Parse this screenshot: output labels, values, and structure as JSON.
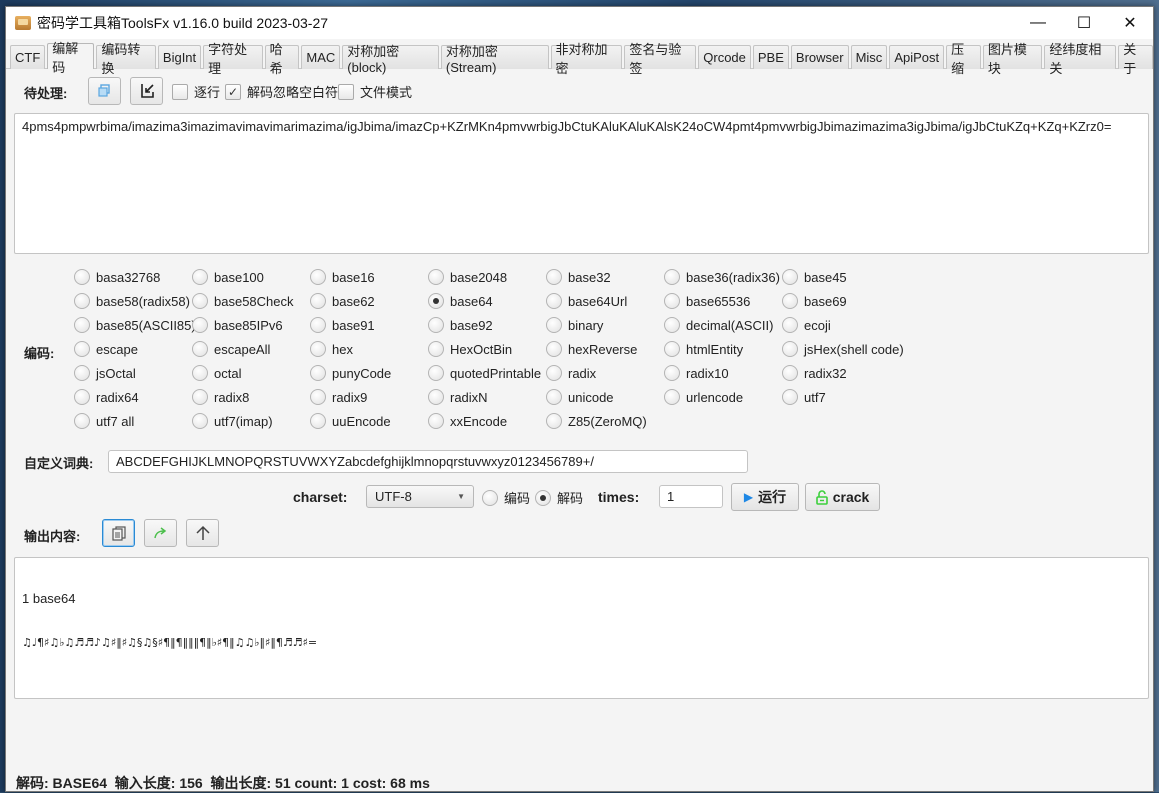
{
  "window": {
    "title": "密码学工具箱ToolsFx v1.16.0 build 2023-03-27",
    "controls": {
      "minimize": "—",
      "maximize": "☐",
      "close": "✕"
    }
  },
  "tabs": [
    {
      "label": "CTF",
      "active": false
    },
    {
      "label": "编解码",
      "active": true
    },
    {
      "label": "编码转换",
      "active": false
    },
    {
      "label": "BigInt",
      "active": false
    },
    {
      "label": "字符处理",
      "active": false
    },
    {
      "label": "哈希",
      "active": false
    },
    {
      "label": "MAC",
      "active": false
    },
    {
      "label": "对称加密(block)",
      "active": false
    },
    {
      "label": "对称加密(Stream)",
      "active": false
    },
    {
      "label": "非对称加密",
      "active": false
    },
    {
      "label": "签名与验签",
      "active": false
    },
    {
      "label": "Qrcode",
      "active": false
    },
    {
      "label": "PBE",
      "active": false
    },
    {
      "label": "Browser",
      "active": false
    },
    {
      "label": "Misc",
      "active": false
    },
    {
      "label": "ApiPost",
      "active": false
    },
    {
      "label": "压缩",
      "active": false
    },
    {
      "label": "图片模块",
      "active": false
    },
    {
      "label": "经纬度相关",
      "active": false
    },
    {
      "label": "关于",
      "active": false
    }
  ],
  "input_section": {
    "label": "待处理:",
    "buttons": [
      {
        "icon": "copy-icon"
      },
      {
        "icon": "import-icon"
      }
    ],
    "options": [
      {
        "label": "逐行",
        "checked": false
      },
      {
        "label": "解码忽略空白符",
        "checked": true
      },
      {
        "label": "文件模式",
        "checked": false
      }
    ],
    "value": "4pms4pmpwrbima/imazima3imazimavimavimarimazima/igJbima/imazCp+KZrMKn4pmvwrbigJbCtuKAluKAluKAlsK24oCW4pmt4pmvwrbigJbimazimazima3igJbima/igJbCtuKZq+KZq+KZrz0="
  },
  "encoding": {
    "label": "编码:",
    "selected": "base64",
    "options": [
      "basa32768",
      "base100",
      "base16",
      "base2048",
      "base32",
      "base36(radix36)",
      "base45",
      "base58(radix58)",
      "base58Check",
      "base62",
      "base64",
      "base64Url",
      "base65536",
      "base69",
      "base85(ASCII85)",
      "base85IPv6",
      "base91",
      "base92",
      "binary",
      "decimal(ASCII)",
      "ecoji",
      "escape",
      "escapeAll",
      "hex",
      "HexOctBin",
      "hexReverse",
      "htmlEntity",
      "jsHex(shell code)",
      "jsOctal",
      "octal",
      "punyCode",
      "quotedPrintable",
      "radix",
      "radix10",
      "radix32",
      "radix64",
      "radix8",
      "radix9",
      "radixN",
      "unicode",
      "urlencode",
      "utf7",
      "utf7 all",
      "utf7(imap)",
      "uuEncode",
      "xxEncode",
      "Z85(ZeroMQ)"
    ]
  },
  "dictionary": {
    "label": "自定义词典:",
    "value": "ABCDEFGHIJKLMNOPQRSTUVWXYZabcdefghijklmnopqrstuvwxyz0123456789+/"
  },
  "controls": {
    "charset_label": "charset:",
    "charset_value": "UTF-8",
    "mode_options": [
      {
        "label": "编码",
        "selected": false
      },
      {
        "label": "解码",
        "selected": true
      }
    ],
    "times_label": "times:",
    "times_value": "1",
    "run_label": "运行",
    "crack_label": "crack",
    "run_icon_color": "#1e88e5",
    "crack_icon_color": "#3ccf3c"
  },
  "output_section": {
    "label": "输出内容:",
    "buttons": [
      {
        "icon": "copy-icon"
      },
      {
        "icon": "forward-icon"
      },
      {
        "icon": "up-arrow-icon"
      }
    ],
    "line1": "1 base64",
    "line2": "♫♩¶♯♫♭♫♬♬♪♫♯‖♯♫§♫§♯¶‖¶‖‖‖¶‖♭♯¶‖♫♫♭‖♯‖¶♬♬♯="
  },
  "status": {
    "text": "解码: BASE64  输入长度: 156  输出长度: 51 count: 1 cost: 68 ms"
  }
}
